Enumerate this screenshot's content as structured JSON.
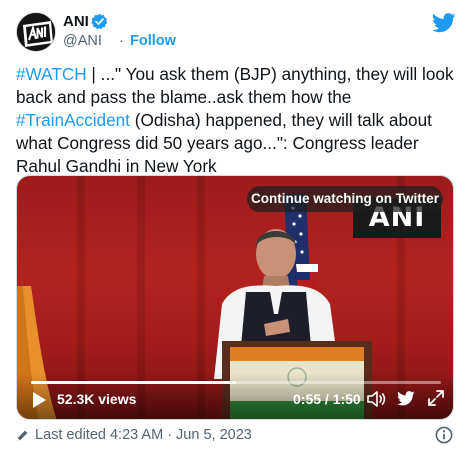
{
  "author": {
    "name": "ANI",
    "handle": "@ANI",
    "separator": "·",
    "follow_label": "Follow",
    "verified": true,
    "avatar_logo_text": "ANI"
  },
  "tweet": {
    "text_parts": [
      {
        "text": "#WATCH",
        "kind": "hashtag"
      },
      {
        "text": " | ...\" You ask them (BJP) anything, they will look back and pass the blame..ask them how the ",
        "kind": "plain"
      },
      {
        "text": "#TrainAccident",
        "kind": "hashtag"
      },
      {
        "text": " (Odisha) happened, they will talk about what Congress did 50 years ago...\": Congress leader Rahul Gandhi in New York",
        "kind": "plain"
      }
    ]
  },
  "video": {
    "continue_label": "Continue watching on Twitter",
    "watermark": "ANI",
    "views": "52.3K views",
    "time": "0:55 / 1:50",
    "progress_fraction": 0.5
  },
  "footer": {
    "edited_label": "Last edited 4:23 AM · Jun 5, 2023"
  },
  "colors": {
    "accent": "#1d9bf0",
    "text": "#0f1419",
    "muted": "#536471"
  },
  "icons": {
    "verified": "verified-badge-icon",
    "brand": "twitter-bird-icon",
    "play": "play-icon",
    "volume": "volume-icon",
    "expand": "expand-icon",
    "edit": "pencil-icon",
    "info": "info-icon"
  }
}
